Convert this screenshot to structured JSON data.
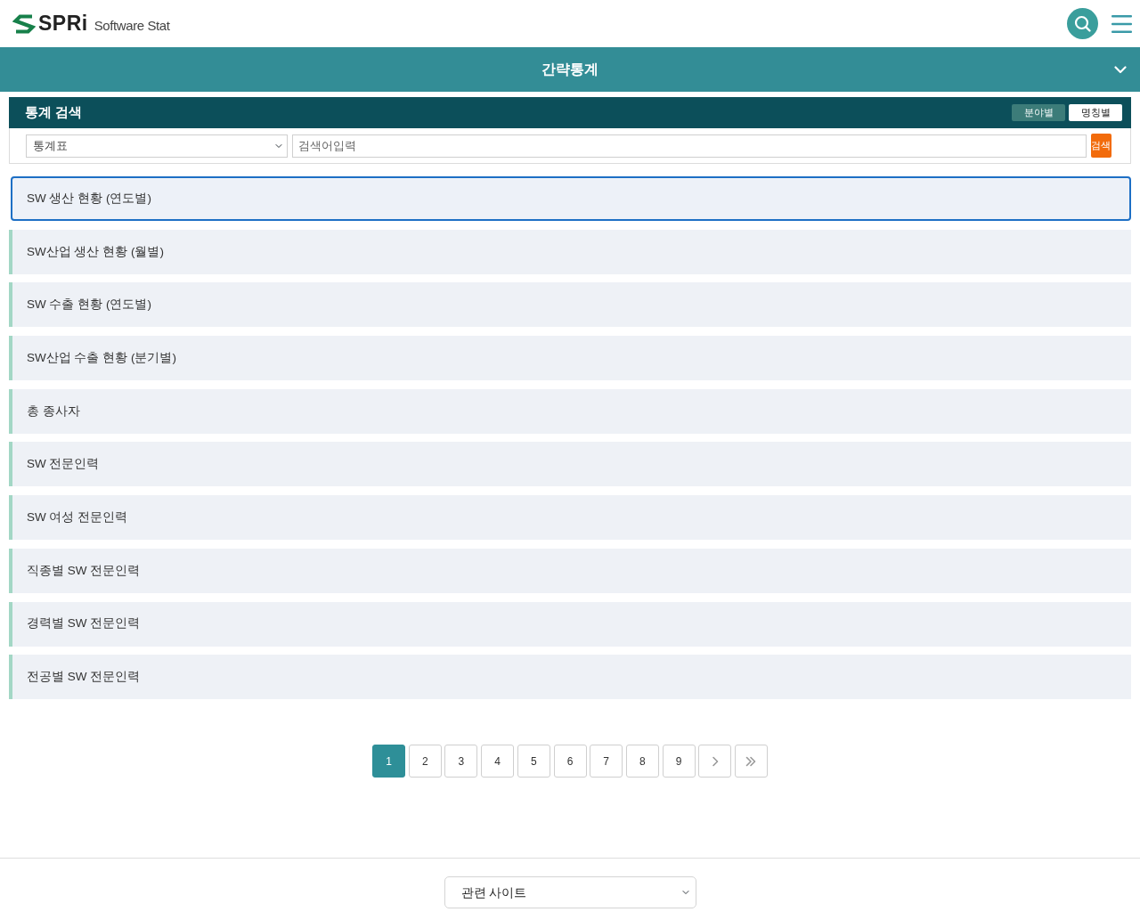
{
  "header": {
    "logo_text": "SPRi",
    "subtitle": "Software Stat"
  },
  "banner": {
    "title": "간략통계",
    "expanded": false
  },
  "search_panel": {
    "title": "통계 검색",
    "view_tabs": [
      {
        "label": "분야별",
        "selected": false
      },
      {
        "label": "명칭별",
        "selected": true
      }
    ],
    "filter": {
      "value": "통계표"
    },
    "query": {
      "placeholder": "검색어입력"
    },
    "button": "검색"
  },
  "results": [
    {
      "title": "SW 생산 현황 (연도별)",
      "selected": true
    },
    {
      "title": "SW산업 생산 현황 (월별)",
      "selected": false
    },
    {
      "title": "SW 수출 현황 (연도별)",
      "selected": false
    },
    {
      "title": "SW산업 수출 현황 (분기별)",
      "selected": false
    },
    {
      "title": "총 종사자",
      "selected": false
    },
    {
      "title": "SW 전문인력",
      "selected": false
    },
    {
      "title": "SW 여성 전문인력",
      "selected": false
    },
    {
      "title": "직종별 SW 전문인력",
      "selected": false
    },
    {
      "title": "경력별 SW 전문인력",
      "selected": false
    },
    {
      "title": "전공별 SW 전문인력",
      "selected": false
    }
  ],
  "pagination": {
    "pages": [
      {
        "label": "1",
        "selected": true
      },
      {
        "label": "2",
        "selected": false
      },
      {
        "label": "3",
        "selected": false
      },
      {
        "label": "4",
        "selected": false
      },
      {
        "label": "5",
        "selected": false
      },
      {
        "label": "6",
        "selected": false
      },
      {
        "label": "7",
        "selected": false
      },
      {
        "label": "8",
        "selected": false
      },
      {
        "label": "9",
        "selected": false
      }
    ]
  },
  "footer": {
    "related_sites": {
      "value": "관련 사이트"
    }
  }
}
